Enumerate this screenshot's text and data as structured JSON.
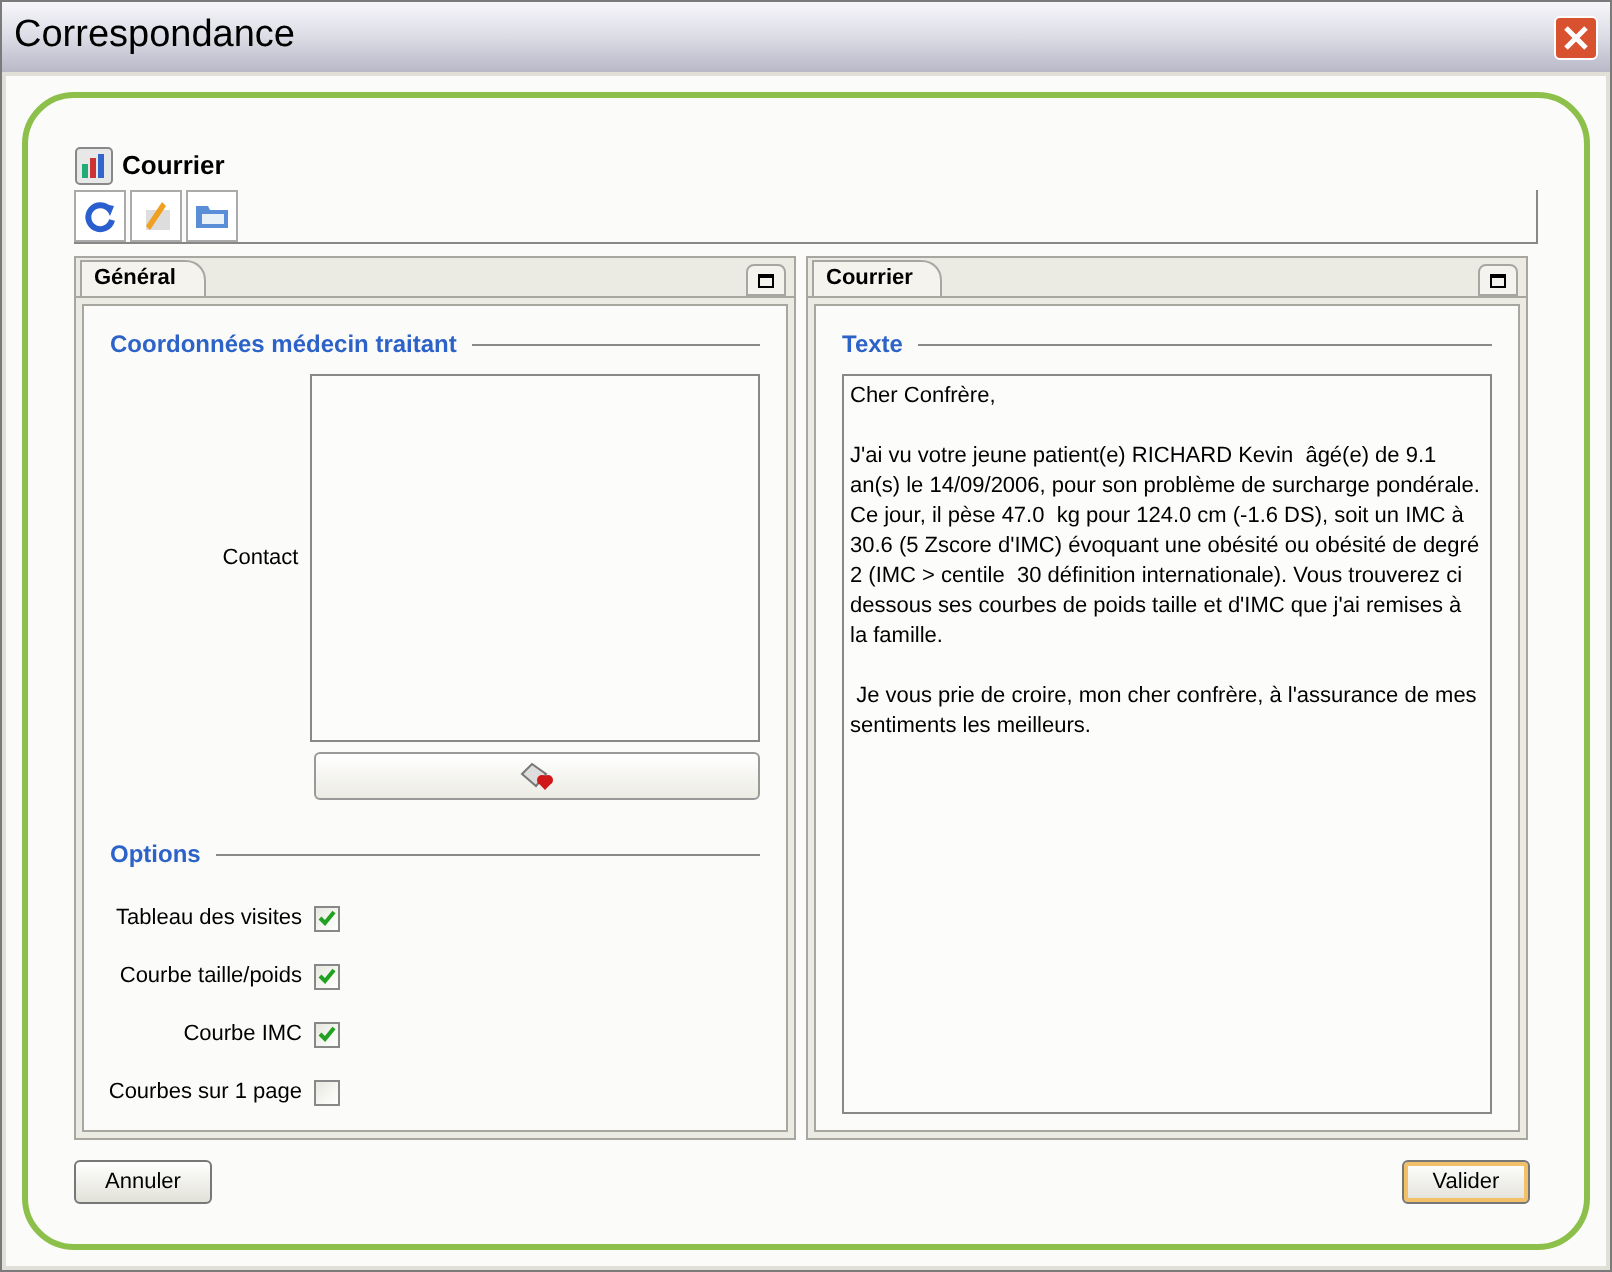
{
  "window": {
    "title": "Correspondance"
  },
  "header": {
    "title": "Courrier"
  },
  "panels": [
    {
      "tab": {
        "label": "Général",
        "selected": true
      },
      "section": "Coordonnées médecin traitant",
      "contact_label": "Contact",
      "options_title": "Options",
      "options": [
        {
          "label": "Tableau des visites",
          "checked": true
        },
        {
          "label": "Courbe taille/poids",
          "checked": true
        },
        {
          "label": "Courbe IMC",
          "checked": true
        },
        {
          "label": "Courbes sur 1 page",
          "checked": false
        }
      ]
    },
    {
      "tab": {
        "label": "Courrier",
        "selected": true
      },
      "section": "Texte",
      "text": "Cher Confrère,\n\nJ'ai vu votre jeune patient(e) RICHARD Kevin  âgé(e) de 9.1 an(s) le 14/09/2006, pour son problème de surcharge pondérale. Ce jour, il pèse 47.0  kg pour 124.0 cm (-1.6 DS), soit un IMC à 30.6 (5 Zscore d'IMC) évoquant une obésité ou obésité de degré 2 (IMC > centile  30 définition internationale). Vous trouverez ci dessous ses courbes de poids taille et d'IMC que j'ai remises à la famille.\n\n Je vous prie de croire, mon cher confrère, à l'assurance de mes sentiments les meilleurs."
    }
  ],
  "buttons": {
    "cancel": "Annuler",
    "ok": "Valider"
  }
}
